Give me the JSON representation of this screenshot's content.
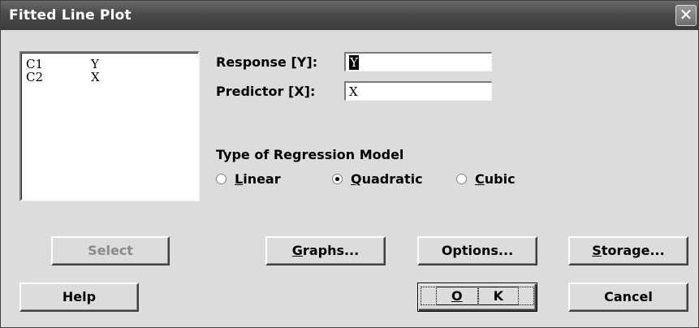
{
  "window": {
    "title": "Fitted Line Plot",
    "close_glyph": "✕"
  },
  "columns": [
    {
      "col": "C1",
      "name": "Y"
    },
    {
      "col": "C2",
      "name": "X"
    }
  ],
  "fields": {
    "response": {
      "label": "Response",
      "key": "[Y]",
      "suffix": ":",
      "value": "Y"
    },
    "predictor": {
      "label": "Predictor",
      "key": "[X]",
      "suffix": ":",
      "value": "X"
    }
  },
  "model": {
    "heading": "Type of Regression Model",
    "options": [
      {
        "label": "Linear",
        "mnemonic": "L",
        "rest": "inear",
        "selected": false
      },
      {
        "label": "Quadratic",
        "mnemonic": "Q",
        "rest": "uadratic",
        "selected": true
      },
      {
        "label": "Cubic",
        "mnemonic": "C",
        "rest": "ubic",
        "selected": false
      }
    ]
  },
  "buttons": {
    "select": "Select",
    "graphs": {
      "label": "Graphs...",
      "mnemonic": "G",
      "rest": "raphs..."
    },
    "options": "Options...",
    "storage": {
      "label": "Storage...",
      "mnemonic": "S",
      "rest": "torage..."
    },
    "help": "Help",
    "ok": {
      "label": "OK",
      "mnemonic": "O",
      "rest": "K"
    },
    "cancel": "Cancel"
  }
}
